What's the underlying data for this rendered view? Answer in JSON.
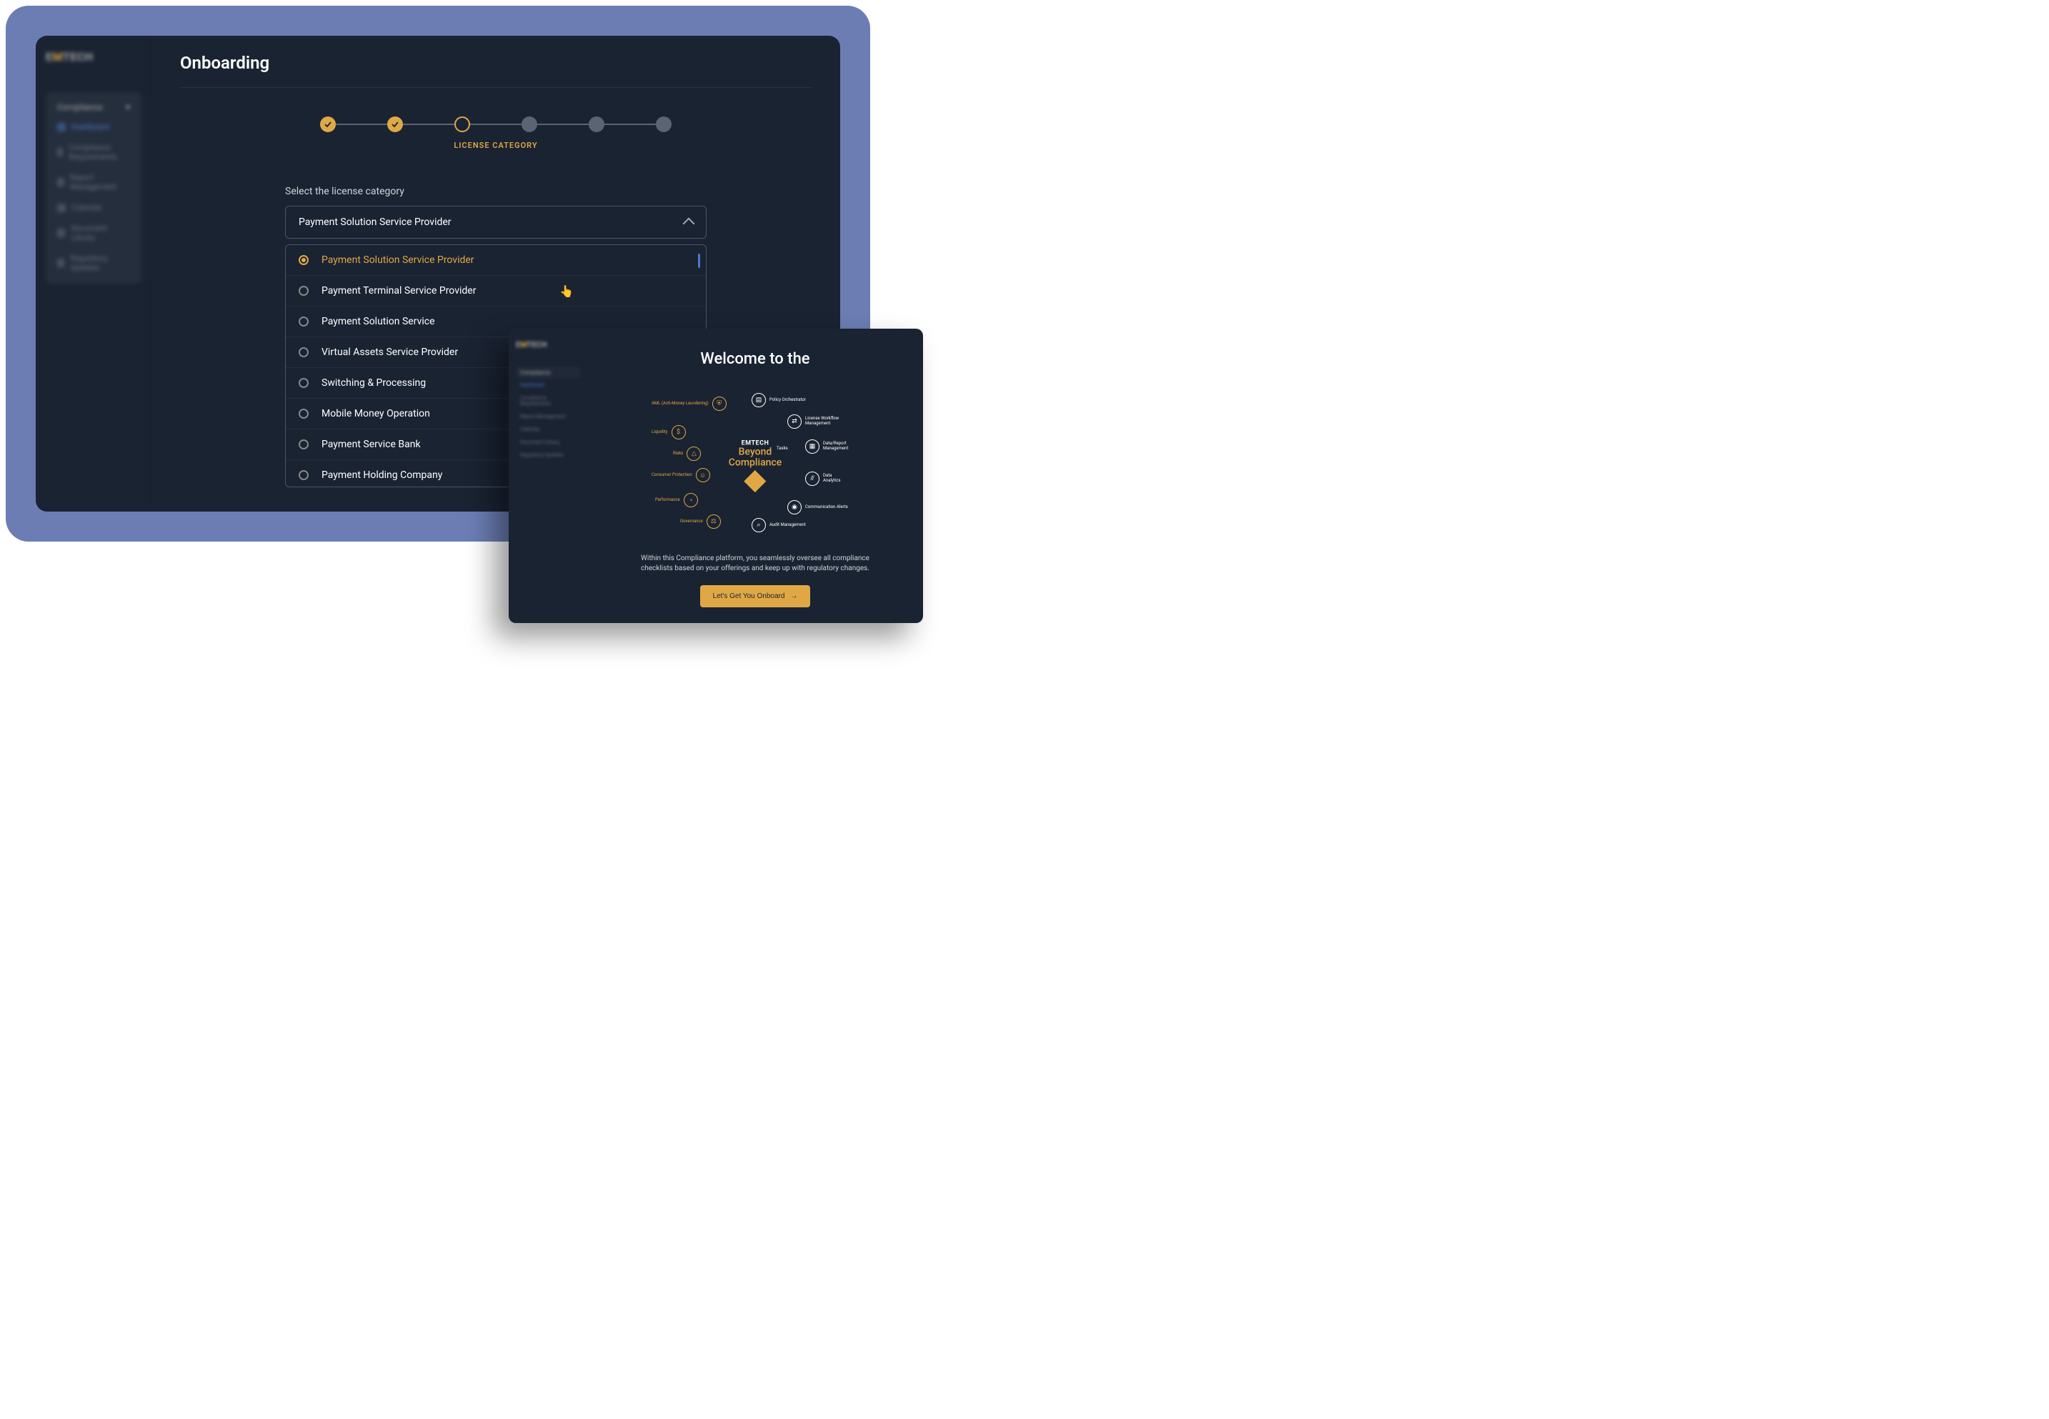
{
  "app": {
    "logo_prefix": "E",
    "logo_mid": "M",
    "logo_suffix": "TECH"
  },
  "sidebar": {
    "section_title": "Compliance",
    "items": [
      {
        "label": "Dashboard",
        "active": true
      },
      {
        "label": "Compliance Requirements",
        "active": false
      },
      {
        "label": "Report Management",
        "active": false
      },
      {
        "label": "Calendar",
        "active": false
      },
      {
        "label": "Document Library",
        "active": false
      },
      {
        "label": "Regulatory Updates",
        "active": false
      }
    ]
  },
  "main": {
    "title": "Onboarding",
    "step_label": "LICENSE CATEGORY",
    "form_label": "Select the license category",
    "selected_value": "Payment Solution Service Provider",
    "options": [
      "Payment Solution Service Provider",
      "Payment Terminal Service Provider",
      "Payment Solution Service",
      "Virtual Assets Service Provider",
      "Switching & Processing",
      "Mobile Money Operation",
      "Payment Service Bank",
      "Payment Holding Company"
    ]
  },
  "secondary": {
    "welcome_title": "Welcome to the",
    "center_brand": "EMTECH",
    "center_line1": "Beyond",
    "center_line2": "Compliance",
    "inner_ring": [
      {
        "label": "AML (Anti-Money Laundering)"
      },
      {
        "label": "Liquidity"
      },
      {
        "label": "Risks"
      },
      {
        "label": "Tasks"
      },
      {
        "label": "Consumer Protection"
      },
      {
        "label": "Performance"
      },
      {
        "label": "Governance"
      }
    ],
    "outer_ring": [
      {
        "label": "Policy Orchestrator"
      },
      {
        "label": "License Workflow Management"
      },
      {
        "label": "Data/Report Management"
      },
      {
        "label": "Data Analytics"
      },
      {
        "label": "Communication Alerts"
      },
      {
        "label": "Audit Management"
      }
    ],
    "description": "Within this Compliance platform, you seamlessly oversee all compliance checklists based on your offerings and keep up with regulatory changes.",
    "cta_label": "Let's Get You Onboard"
  }
}
